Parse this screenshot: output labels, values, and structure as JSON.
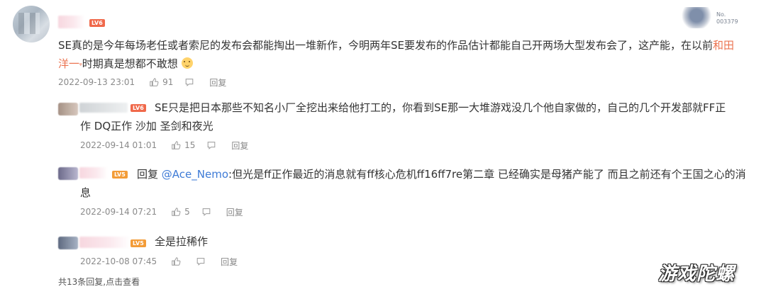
{
  "main_comment": {
    "level": "LV6",
    "badge_no_label": "No.",
    "badge_no_value": "003379",
    "text_part1": "SE真的是今年每场老任或者索尼的发布会都能掏出一堆新作，今明两年SE要发布的作品估计都能自己开两场大型发布会了，这产能，在以前",
    "mention": "和田",
    "text_line2_mention": "洋一",
    "text_part2": "时期真是想都不敢想",
    "time": "2022-09-13 23:01",
    "likes": "91",
    "reply_label": "回复"
  },
  "replies": [
    {
      "level": "LV6",
      "text_line1": "SE只是把日本那些不知名小厂全挖出来给他打工的，你看到SE那一大堆游戏没几个他自家做的，自己的几个开发部就FF正",
      "text_line2": "作 DQ正作 沙加 圣剑和夜光",
      "time": "2022-09-14 01:01",
      "likes": "15",
      "reply_label": "回复"
    },
    {
      "level": "LV5",
      "prefix": "回复",
      "mention": "@Ace_Nemo",
      "text_line1": ":但光是ff正作最近的消息就有ff核心危机ff16ff7re第二章 已经确实是母猪产能了 而且之前还有个王国之心的消",
      "text_line2": "息",
      "time": "2022-09-14 07:21",
      "likes": "5",
      "reply_label": "回复"
    },
    {
      "level": "LV5",
      "text_line1": "全是拉稀作",
      "time": "2022-10-08 07:45",
      "likes": "",
      "reply_label": "回复"
    }
  ],
  "footer": {
    "count_text": "共13条回复,",
    "view_text": "点击查看"
  },
  "watermark": "游戏陀螺"
}
